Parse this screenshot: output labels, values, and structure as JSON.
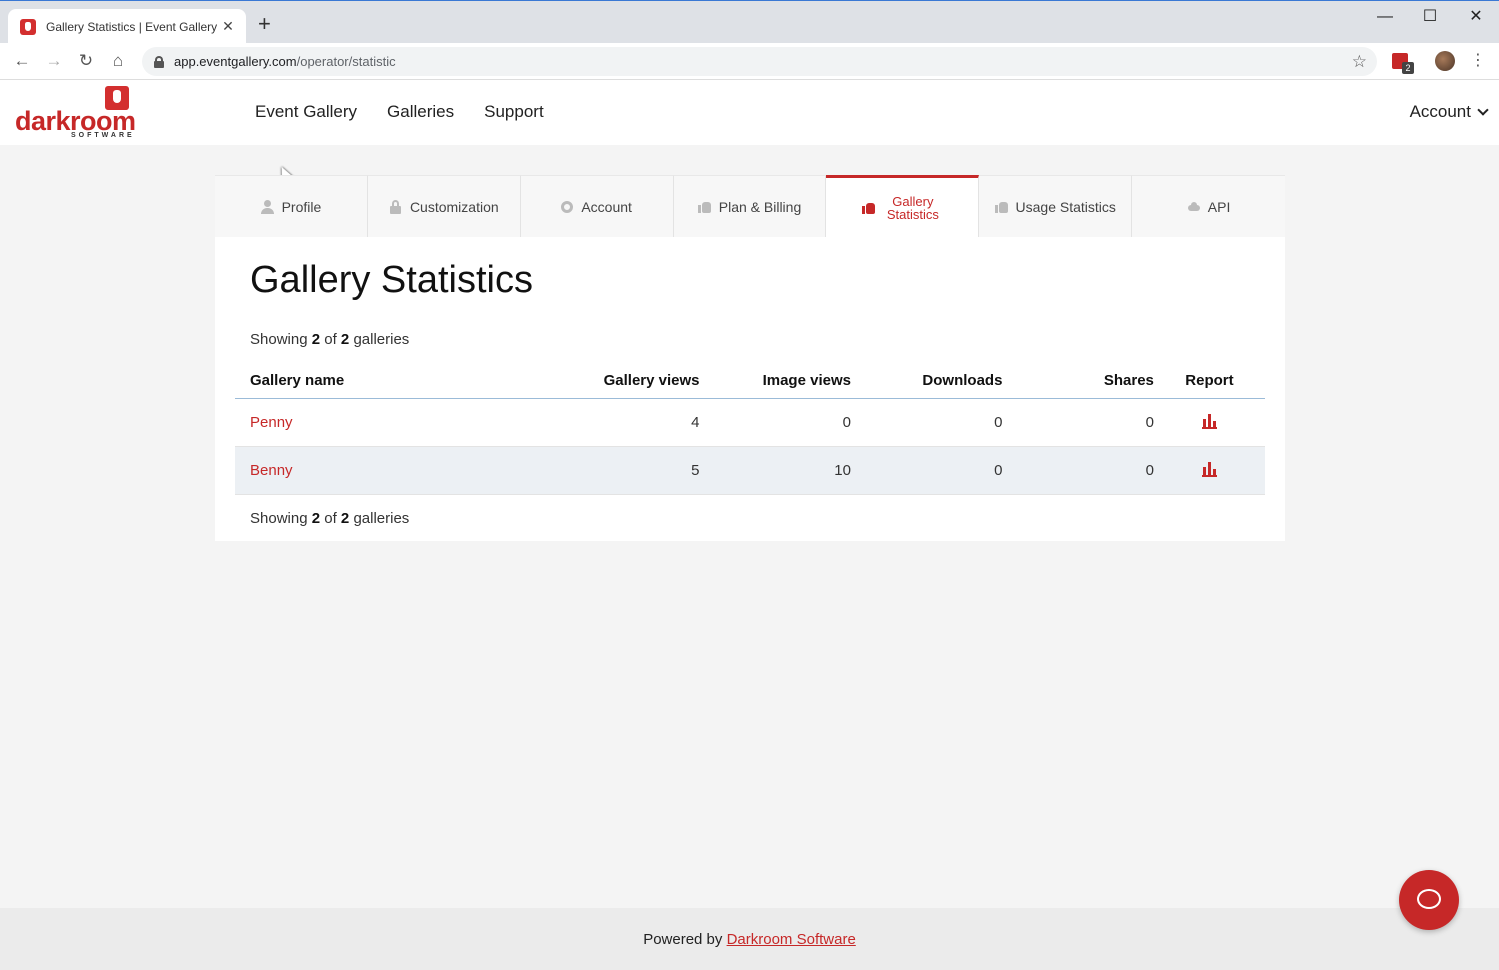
{
  "browser": {
    "tab_title": "Gallery Statistics | Event Gallery",
    "url_host": "app.eventgallery.com",
    "url_path": "/operator/statistic",
    "extension_badge": "2"
  },
  "header": {
    "logo_text": "darkroom",
    "logo_subtext": "SOFTWARE",
    "nav": [
      "Event Gallery",
      "Galleries",
      "Support"
    ],
    "account_label": "Account"
  },
  "settings_tabs": [
    {
      "label": "Profile",
      "icon": "user-icon"
    },
    {
      "label": "Customization",
      "icon": "lock-icon"
    },
    {
      "label": "Account",
      "icon": "gear-icon"
    },
    {
      "label": "Plan & Billing",
      "icon": "thumbs-up-icon"
    },
    {
      "label": "Gallery Statistics",
      "icon": "thumbs-up-icon",
      "active": true
    },
    {
      "label": "Usage Statistics",
      "icon": "thumbs-up-icon"
    },
    {
      "label": "API",
      "icon": "cloud-icon"
    }
  ],
  "page": {
    "title": "Gallery Statistics",
    "showing_prefix": "Showing",
    "showing_count": "2",
    "showing_of": "of",
    "showing_total": "2",
    "showing_suffix": "galleries"
  },
  "table": {
    "headers": {
      "name": "Gallery name",
      "gallery_views": "Gallery views",
      "image_views": "Image views",
      "downloads": "Downloads",
      "shares": "Shares",
      "report": "Report"
    },
    "rows": [
      {
        "name": "Penny",
        "gallery_views": "4",
        "image_views": "0",
        "downloads": "0",
        "shares": "0",
        "report_icon": "bar-chart-icon"
      },
      {
        "name": "Benny",
        "gallery_views": "5",
        "image_views": "10",
        "downloads": "0",
        "shares": "0",
        "report_icon": "bar-chart-icon"
      }
    ]
  },
  "footer": {
    "prefix": "Powered by",
    "link": "Darkroom Software"
  },
  "colors": {
    "accent": "#c62828",
    "page_bg": "#f4f4f4",
    "alt_row": "#ecf0f4"
  }
}
